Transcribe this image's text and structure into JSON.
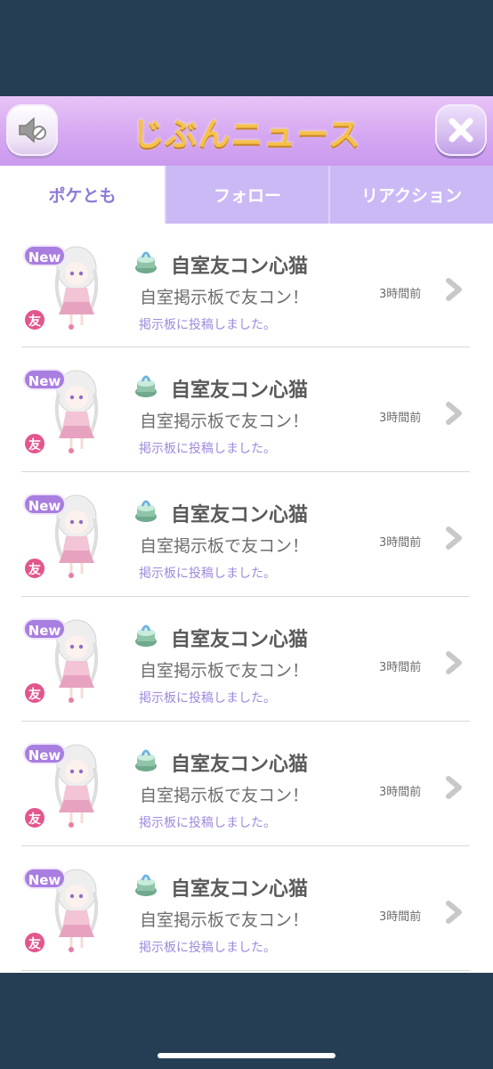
{
  "header": {
    "title": "じぶんニュース",
    "sound_icon": "speaker-muted-icon",
    "close_icon": "close-x-icon"
  },
  "tabs": [
    {
      "label": "ポケとも",
      "active": true
    },
    {
      "label": "フォロー",
      "active": false
    },
    {
      "label": "リアクション",
      "active": false
    }
  ],
  "items": [
    {
      "badge": "New",
      "friend": "友",
      "title": "自室友コン心猫",
      "subtitle": "自室掲示板で友コン！",
      "note": "掲示板に投稿しました。",
      "time": "3時間前"
    },
    {
      "badge": "New",
      "friend": "友",
      "title": "自室友コン心猫",
      "subtitle": "自室掲示板で友コン！",
      "note": "掲示板に投稿しました。",
      "time": "3時間前"
    },
    {
      "badge": "New",
      "friend": "友",
      "title": "自室友コン心猫",
      "subtitle": "自室掲示板で友コン！",
      "note": "掲示板に投稿しました。",
      "time": "3時間前"
    },
    {
      "badge": "New",
      "friend": "友",
      "title": "自室友コン心猫",
      "subtitle": "自室掲示板で友コン！",
      "note": "掲示板に投稿しました。",
      "time": "3時間前"
    },
    {
      "badge": "New",
      "friend": "友",
      "title": "自室友コン心猫",
      "subtitle": "自室掲示板で友コン！",
      "note": "掲示板に投稿しました。",
      "time": "3時間前"
    },
    {
      "badge": "New",
      "friend": "友",
      "title": "自室友コン心猫",
      "subtitle": "自室掲示板で友コン！",
      "note": "掲示板に投稿しました。",
      "time": "3時間前"
    }
  ],
  "colors": {
    "page_bg": "#253e54",
    "header_gradient": "#d6a8f1",
    "title_gold": "#f6c14a",
    "tab_active_text": "#8f7ad8",
    "tab_inactive_bg": "#cbb9f5",
    "new_badge": "#a87ee0",
    "friend_badge": "#e2568f"
  }
}
